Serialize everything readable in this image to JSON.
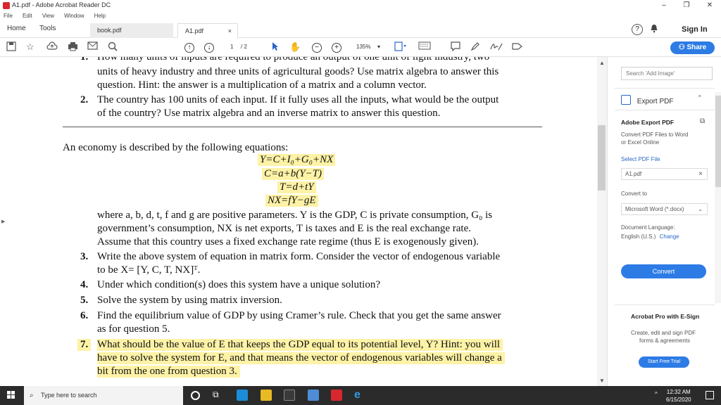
{
  "window": {
    "title": "A1.pdf - Adobe Acrobat Reader DC",
    "minimize": "–",
    "maximize": "❐",
    "close": "✕"
  },
  "menubar": [
    "File",
    "Edit",
    "View",
    "Window",
    "Help"
  ],
  "tabs": {
    "home": "Home",
    "tools": "Tools",
    "docs": [
      {
        "label": "book.pdf",
        "close": ""
      },
      {
        "label": "A1.pdf",
        "close": "×"
      }
    ],
    "help": "?",
    "signin": "Sign In"
  },
  "toolbar": {
    "page_current": "1",
    "page_total": "/ 2",
    "zoom": "135%",
    "share": "Share"
  },
  "document": {
    "lines": [
      {
        "num": "1.",
        "text": "How many units of inputs are required to produce an output of one unit of light industry, two"
      },
      {
        "num": "",
        "text": "units of heavy industry and three units of agricultural goods? Use matrix algebra to answer this"
      },
      {
        "num": "",
        "text": "question. Hint: the answer is a multiplication of a matrix and a column vector."
      },
      {
        "num": "2.",
        "text": "The country has 100 units of each input. If it fully uses all the inputs, what would be the output"
      },
      {
        "num": "",
        "text": "of the country? Use matrix algebra and an inverse matrix to answer this question."
      }
    ],
    "intro": "An economy is described by the following equations:",
    "equations": [
      "Y=C+I₀+G₀+NX",
      "C=a+b(Y−T)",
      "T=d+tY",
      "NX=fY−gE"
    ],
    "para": [
      "where a, b, d, t, f and g are positive parameters. Y is the GDP, C is private consumption, G₀ is",
      "government’s consumption, NX is net exports, T is taxes and E is the real exchange rate.",
      "Assume that this country uses a fixed exchange rate regime (thus E is exogenously given)."
    ],
    "items": [
      {
        "num": "3.",
        "lines": [
          "Write the above system of equation in matrix form. Consider the vector of endogenous variable",
          "to be X= [Y, C, T, NX]ᵀ."
        ]
      },
      {
        "num": "4.",
        "lines": [
          "Under which condition(s) does this system have a unique solution?"
        ]
      },
      {
        "num": "5.",
        "lines": [
          "Solve the system by using matrix inversion."
        ]
      },
      {
        "num": "6.",
        "lines": [
          "Find the equilibrium value of GDP by using Cramer’s rule. Check that you get the same answer",
          "as for question 5."
        ]
      },
      {
        "num": "7.",
        "lines": [
          "What should be the value of E that keeps the GDP equal to its potential level, Y? Hint: you will",
          "have to solve the system for E, and that means the vector of endogenous variables will change a",
          "bit from the one from question 3."
        ]
      }
    ]
  },
  "sidebar": {
    "search_placeholder": "Search 'Add Image'",
    "export_title": "Export PDF",
    "panel_title": "Adobe Export PDF",
    "panel_desc": [
      "Convert PDF Files to Word",
      "or Excel Online"
    ],
    "select_label": "Select PDF File",
    "selected_file": "A1.pdf",
    "convert_to": "Convert to",
    "format": "Microsoft Word (*.docx)",
    "doc_lang_label": "Document Language:",
    "doc_lang": "English (U.S.)",
    "change": "Change",
    "convert_button": "Convert",
    "pro_title": "Acrobat Pro with E-Sign",
    "pro_desc": [
      "Create, edit and sign PDF",
      "forms & agreements"
    ],
    "trial_button": "Start Free Trial"
  },
  "taskbar": {
    "search_placeholder": "Type here to search",
    "time": "12:32 AM",
    "date": "6/15/2020"
  },
  "colors": {
    "accent": "#2d7be5",
    "highlight": "#fdf2a6",
    "taskbar": "#2b2b2b"
  }
}
